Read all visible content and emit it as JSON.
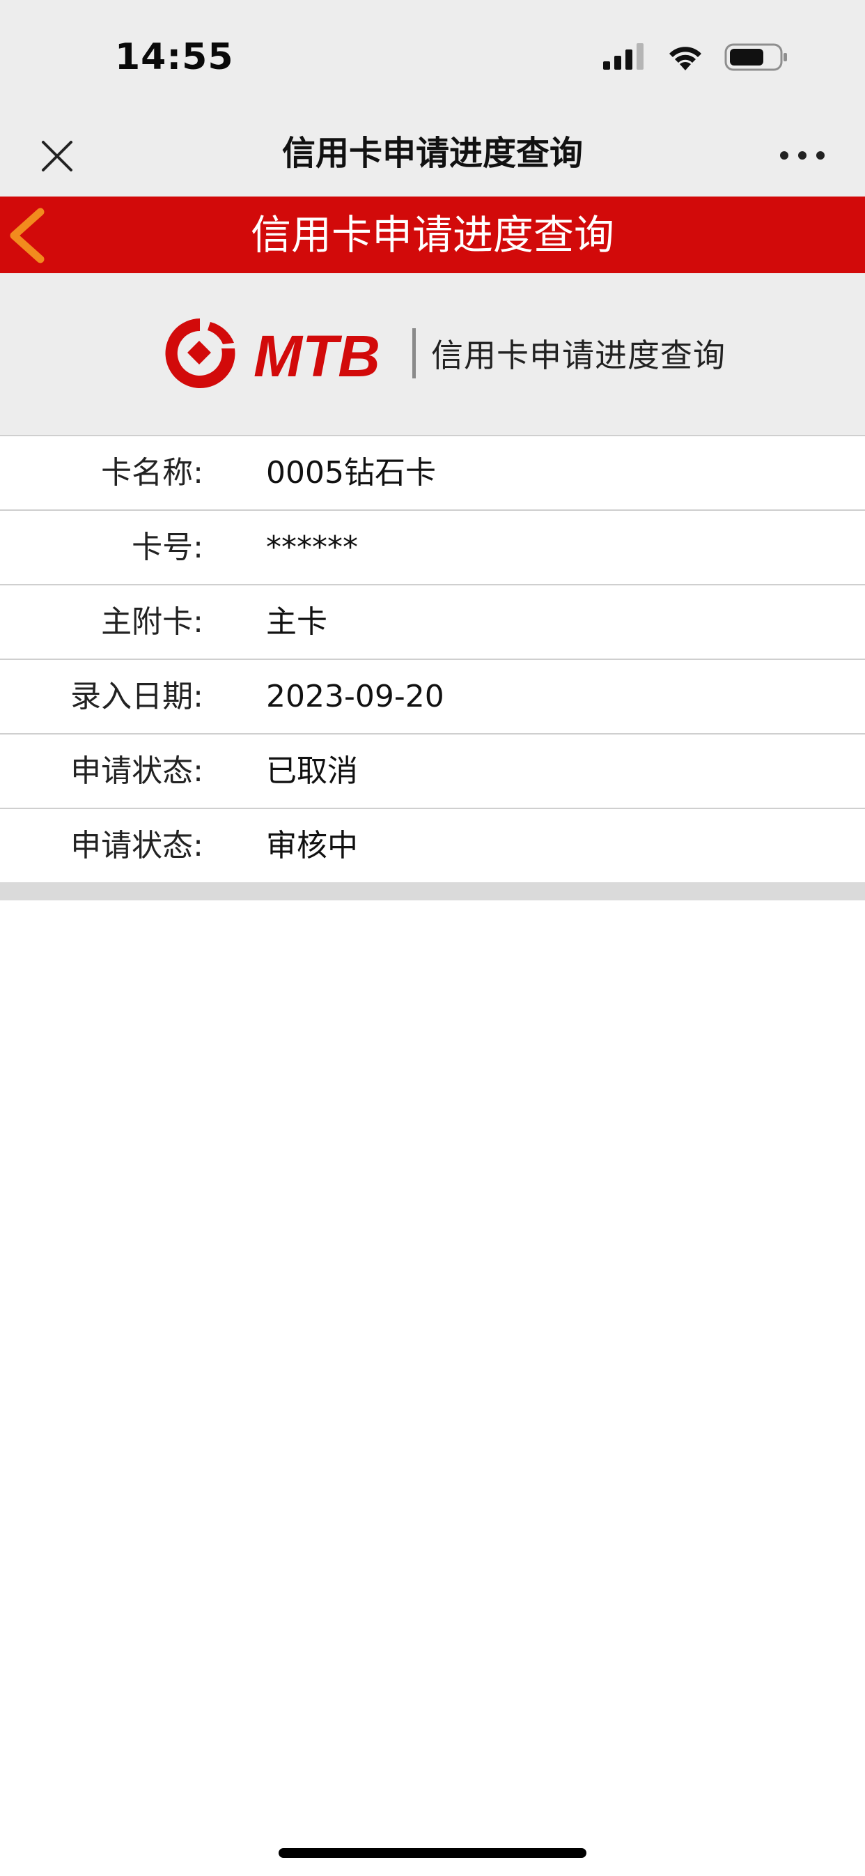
{
  "status_bar": {
    "time": "14:55"
  },
  "nav_bar": {
    "title": "信用卡申请进度查询"
  },
  "header": {
    "title": "信用卡申请进度查询"
  },
  "logo": {
    "brand": "MTB",
    "subtitle": "信用卡申请进度查询"
  },
  "details": [
    {
      "label": "卡名称:",
      "value": "0005钻石卡"
    },
    {
      "label": "卡号:",
      "value": "******"
    },
    {
      "label": "主附卡:",
      "value": "主卡"
    },
    {
      "label": "录入日期:",
      "value": "2023-09-20"
    },
    {
      "label": "申请状态:",
      "value": "已取消"
    },
    {
      "label": "申请状态:",
      "value": "审核中"
    }
  ],
  "colors": {
    "header_red": "#d20a0a",
    "back_arrow": "#f28b1e",
    "logo_red": "#d20a0a",
    "page_gray": "#ededed"
  }
}
